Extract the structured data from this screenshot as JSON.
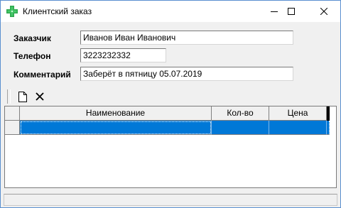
{
  "window": {
    "title": "Клиентский заказ",
    "controls": [
      "minimize",
      "maximize",
      "close"
    ]
  },
  "form": {
    "customer_label": "Заказчик",
    "customer_value": "Иванов Иван Иванович",
    "phone_label": "Телефон",
    "phone_value": "3223232332",
    "comment_label": "Комментарий",
    "comment_value": "Заберёт в пятницу 05.07.2019"
  },
  "toolbar": {
    "buttons": [
      {
        "name": "new-document-icon"
      },
      {
        "name": "delete-icon"
      }
    ]
  },
  "grid": {
    "columns": [
      "Наименование",
      "Кол-во",
      "Цена"
    ],
    "rows": [
      {
        "name": "",
        "qty": "",
        "price": "",
        "selected": true
      }
    ]
  },
  "colors": {
    "selection": "#0078d7",
    "accent_icon": "#2fa84f"
  }
}
